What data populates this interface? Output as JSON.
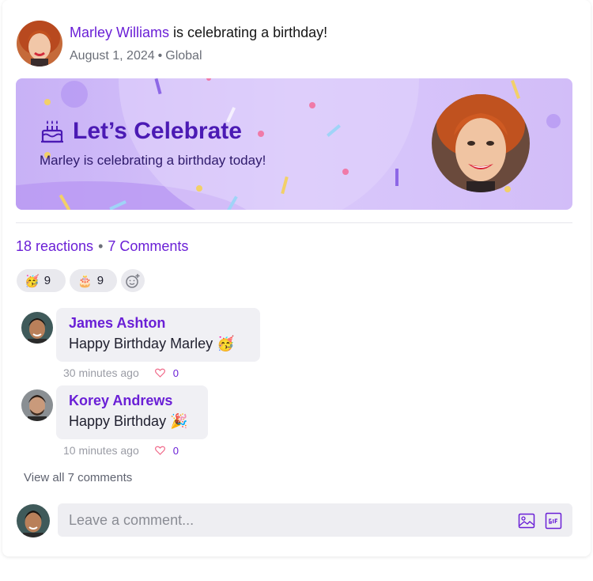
{
  "post": {
    "author_name": "Marley Williams",
    "headline_rest": "is celebrating a birthday!",
    "date": "August 1, 2024",
    "dot": "•",
    "audience": "Global"
  },
  "banner": {
    "title": "Let’s Celebrate",
    "subtitle": "Marley is celebrating a birthday today!"
  },
  "summary": {
    "reactions": "18 reactions",
    "sep": "•",
    "comments": "7 Comments"
  },
  "reactions": [
    {
      "emoji": "🥳",
      "count": "9"
    },
    {
      "emoji": "🎂",
      "count": "9"
    }
  ],
  "comments": [
    {
      "name": "James Ashton",
      "text": "Happy Birthday Marley 🥳",
      "time": "30 minutes ago",
      "likes": "0"
    },
    {
      "name": "Korey Andrews",
      "text": "Happy Birthday 🎉",
      "time": "10 minutes ago",
      "likes": "0"
    }
  ],
  "view_all": "View all 7 comments",
  "composer": {
    "placeholder": "Leave a comment...",
    "icons": [
      "image-icon",
      "gif-icon"
    ]
  },
  "colors": {
    "accent": "#6a1fd6",
    "banner": "#d4c0f8",
    "bubble": "#f0f0f4"
  }
}
